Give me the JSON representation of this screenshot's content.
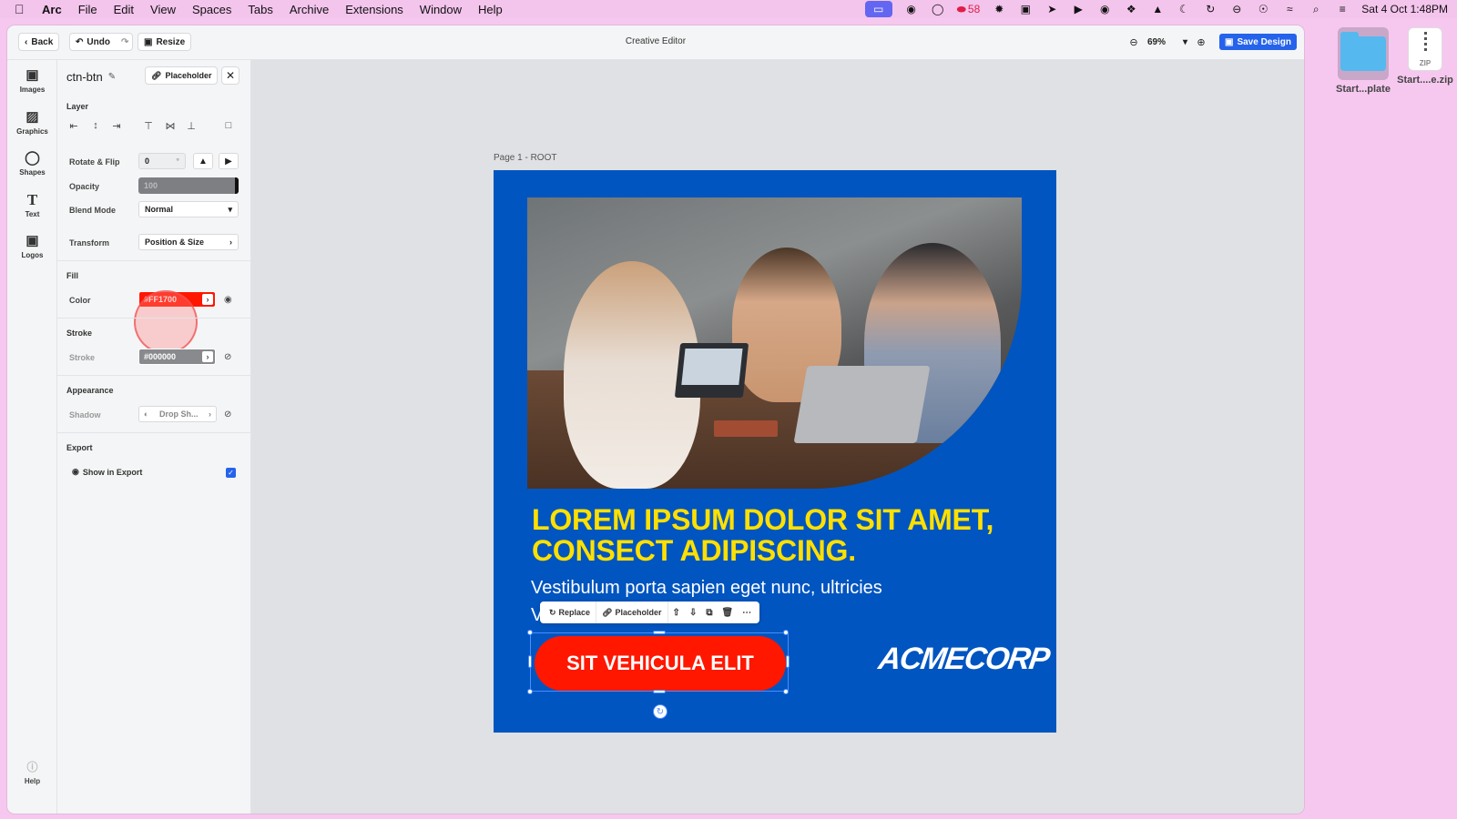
{
  "menubar": {
    "app": "Arc",
    "items": [
      "File",
      "Edit",
      "View",
      "Spaces",
      "Tabs",
      "Archive",
      "Extensions",
      "Window",
      "Help"
    ],
    "badge_count": "58",
    "datetime": "Sat 4 Oct  1:48PM"
  },
  "desktop": {
    "folder_label": "Start...plate",
    "zip_label": "Start....e.zip",
    "zip_tag": "ZIP"
  },
  "topbar": {
    "back": "Back",
    "undo": "Undo",
    "resize": "Resize",
    "title": "Creative Editor",
    "zoom": "69%",
    "save": "Save Design"
  },
  "rail": {
    "items": [
      {
        "label": "Images",
        "icon": "image-icon"
      },
      {
        "label": "Graphics",
        "icon": "graphics-icon"
      },
      {
        "label": "Shapes",
        "icon": "shapes-icon"
      },
      {
        "label": "Text",
        "icon": "text-icon"
      },
      {
        "label": "Logos",
        "icon": "logos-icon"
      }
    ],
    "help": "Help"
  },
  "panel": {
    "element_name": "ctn-btn",
    "placeholder": "Placeholder",
    "layer_heading": "Layer",
    "rotate_label": "Rotate & Flip",
    "rotate_value": "0",
    "rotate_unit": "°",
    "opacity_label": "Opacity",
    "opacity_value": "100",
    "blend_label": "Blend Mode",
    "blend_value": "Normal",
    "transform_label": "Transform",
    "transform_value": "Position & Size",
    "fill_heading": "Fill",
    "color_label": "Color",
    "color_value": "#FF1700",
    "stroke_heading": "Stroke",
    "stroke_label": "Stroke",
    "stroke_value": "#000000",
    "appearance_heading": "Appearance",
    "shadow_label": "Shadow",
    "shadow_value": "Drop Sh...",
    "export_heading": "Export",
    "show_in_export": "Show in Export",
    "show_in_export_checked": true
  },
  "canvas": {
    "page_label": "Page 1 - ROOT",
    "headline": "LOREM IPSUM DOLOR SIT AMET, CONSECT ADIPISCING.",
    "subline": "Vestibulum porta sapien eget nunc, ultricies",
    "subline_cut": "V",
    "cta": "SIT VEHICULA ELIT",
    "logo": "ACMECORP",
    "float_toolbar": {
      "replace": "Replace",
      "placeholder": "Placeholder"
    }
  },
  "colors": {
    "artboard": "#0055C0",
    "headline": "#FFE000",
    "cta": "#FF1700",
    "accent": "#2563EB"
  }
}
